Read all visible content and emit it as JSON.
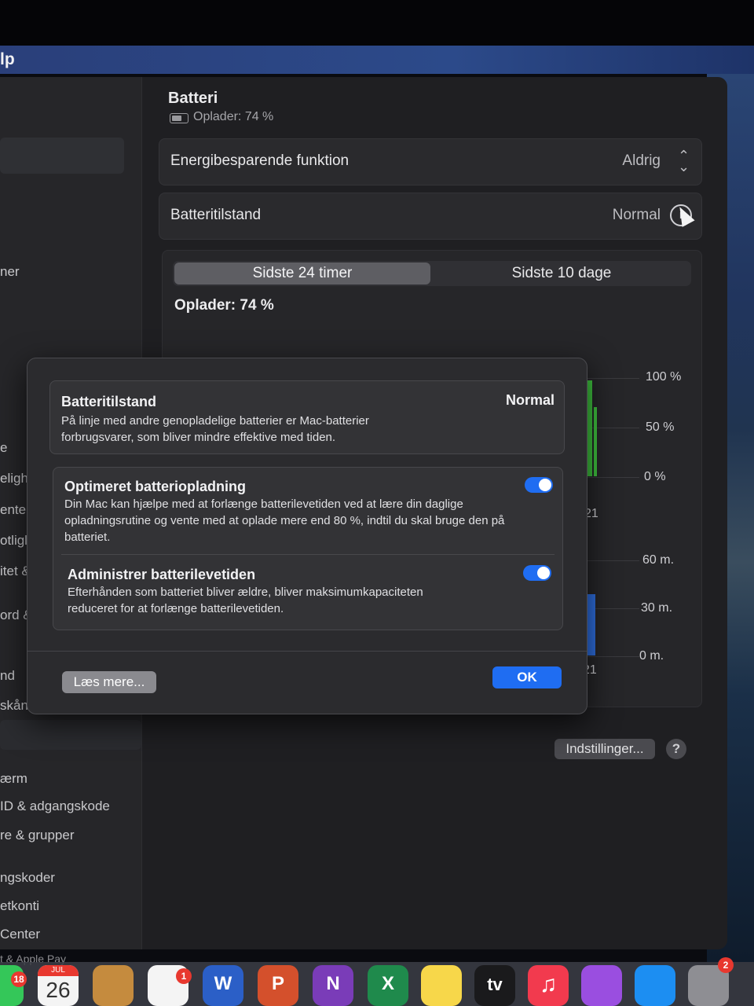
{
  "menubar": {
    "app_menu_fragment": "lp"
  },
  "sidebar": {
    "items": [
      "ner",
      "e",
      "eligh",
      "enter",
      "otligl",
      "itet &",
      "ord &",
      "nd",
      "skåner",
      "ærm",
      "ID & adgangskode",
      "re & grupper",
      "ngskoder",
      "etkonti",
      "Center",
      "t & Apple Pay"
    ]
  },
  "pane": {
    "title": "Batteri",
    "subtitle": "Oplader: 74 %",
    "energy_row": {
      "label": "Energibesparende funktion",
      "value": "Aldrig"
    },
    "health_row": {
      "label": "Batteritilstand",
      "value": "Normal"
    },
    "tabs": [
      "Sidste 24 timer",
      "Sidste 10 dage"
    ],
    "charge_label": "Oplader: 74 %",
    "level_axis": [
      "100 %",
      "50 %",
      "0 %"
    ],
    "level_tick": "21",
    "usage_axis": [
      "60 m.",
      "30 m.",
      "0 m."
    ],
    "usage_tick": "21",
    "settings_button": "Indstillinger...",
    "help_button": "?"
  },
  "dialog": {
    "health": {
      "title": "Batteritilstand",
      "value": "Normal",
      "body": "På linje med andre genopladelige batterier er Mac-batterier forbrugsvarer, som bliver mindre effektive med tiden."
    },
    "optimized": {
      "title": "Optimeret batteriopladning",
      "body": "Din Mac kan hjælpe med at forlænge batterilevetiden ved at lære din daglige opladningsrutine og vente med at oplade mere end 80 %, indtil du skal bruge den på batteriet.",
      "enabled": true
    },
    "manage": {
      "title": "Administrer batterilevetiden",
      "body": "Efterhånden som batteriet bliver ældre, bliver maksimumkapaciteten reduceret for at forlænge batterilevetiden.",
      "enabled": true
    },
    "learn_more_button": "Læs mere...",
    "ok_button": "OK"
  },
  "dock": {
    "calendar_month": "JUL",
    "calendar_day": "26",
    "badges": {
      "messages": "18",
      "reminders": "1",
      "settings": "2"
    },
    "tv_label": "tv",
    "word_letter": "W",
    "powerpoint_letter": "P",
    "onenote_letter": "N",
    "excel_letter": "X"
  },
  "colors": {
    "accent": "#1f6df2",
    "battery_green": "#3fc23f",
    "usage_blue": "#2f6fe0"
  }
}
